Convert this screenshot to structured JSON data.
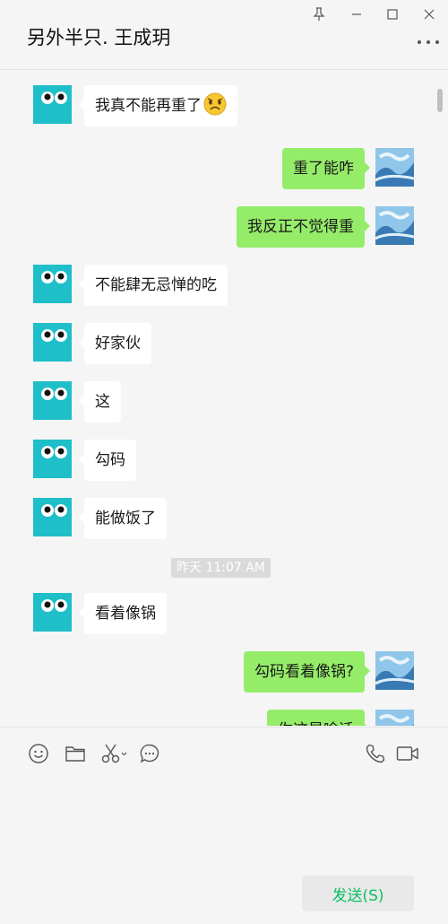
{
  "chat": {
    "title": "另外半只. 王成玥"
  },
  "messages": [
    {
      "side": "left",
      "text": "我真不能再重了",
      "emoji": "worried-face"
    },
    {
      "side": "right",
      "text": "重了能咋"
    },
    {
      "side": "right",
      "text": "我反正不觉得重"
    },
    {
      "side": "left",
      "text": "不能肆无忌惮的吃"
    },
    {
      "side": "left",
      "text": "好家伙"
    },
    {
      "side": "left",
      "text": "这"
    },
    {
      "side": "left",
      "text": "勾码"
    },
    {
      "side": "left",
      "text": "能做饭了"
    },
    {
      "side": "left",
      "text": "看着像锅"
    },
    {
      "side": "right",
      "text": "勾码看着像锅?"
    },
    {
      "side": "right",
      "text": "你这是啥话"
    }
  ],
  "timestamp": "昨天 11:07 AM",
  "toolbar": {
    "icons": [
      "emoji-icon",
      "folder-icon",
      "scissors-icon",
      "chat-bubble-icon",
      "phone-icon",
      "video-icon"
    ]
  },
  "send_button": {
    "label": "发送(S)"
  },
  "colors": {
    "bubble_self": "#95ec69",
    "bubble_other": "#ffffff",
    "accent": "#07c160",
    "avatar_teal": "#1ebfc9"
  }
}
